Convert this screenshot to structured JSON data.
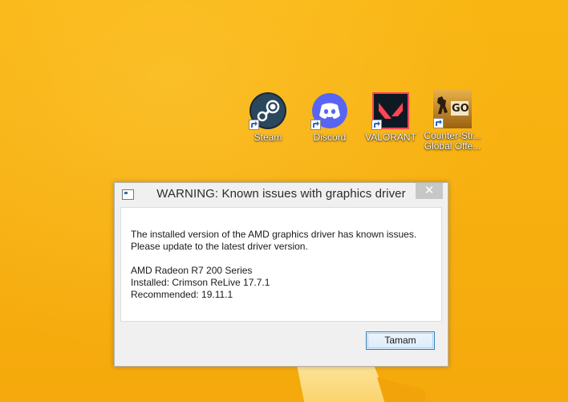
{
  "desktop": {
    "icons": [
      {
        "label": "Steam",
        "icon": "steam-icon"
      },
      {
        "label": "Discord",
        "icon": "discord-icon"
      },
      {
        "label": "VALORANT",
        "icon": "valorant-icon"
      },
      {
        "label": "Counter-Str... Global Offe...",
        "icon": "csgo-icon",
        "logo_text": "GO"
      }
    ]
  },
  "dialog": {
    "title": "WARNING: Known issues with graphics driver",
    "close_label": "✕",
    "message_line1": "The installed version of the AMD graphics driver has known issues.",
    "message_line2": "Please update to the latest driver version.",
    "gpu": "AMD Radeon R7 200 Series",
    "installed": "Installed: Crimson ReLive 17.7.1",
    "recommended": "Recommended: 19.11.1",
    "ok_label": "Tamam"
  },
  "colors": {
    "wallpaper": "#f7b010",
    "valorant_red": "#fd4556",
    "discord_blue": "#5865f2",
    "steam_blue": "#1b2838"
  }
}
